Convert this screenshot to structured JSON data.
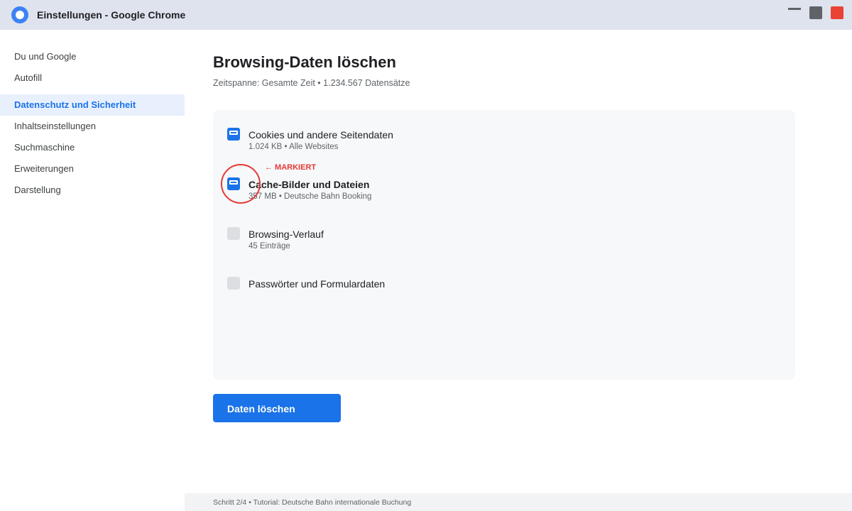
{
  "window": {
    "title": "Einstellungen - Google Chrome"
  },
  "sidebar": {
    "items": [
      {
        "label": "Du und Google"
      },
      {
        "label": "Autofill"
      },
      {
        "label": "Datenschutz und Sicherheit",
        "active": true
      },
      {
        "label": "Inhaltseinstellungen"
      },
      {
        "label": "Suchmaschine"
      },
      {
        "label": "Erweiterungen"
      },
      {
        "label": "Darstellung"
      }
    ]
  },
  "main": {
    "title": "Browsing-Daten löschen",
    "subtitle": "Zeitspanne: Gesamte Zeit • 1.234.567 Datensätze",
    "items": [
      {
        "label": "Cookies und andere Seitendaten",
        "meta": "1.024 KB • Alle Websites",
        "checked": true
      },
      {
        "label": "Cache-Bilder und Dateien",
        "meta": "357 MB • Deutsche Bahn Booking",
        "checked": true
      },
      {
        "label": "Browsing-Verlauf",
        "meta": "45 Einträge",
        "checked": false
      },
      {
        "label": "Passwörter und Formulardaten",
        "checked": false
      }
    ],
    "annotation": "← MARKIERT",
    "delete_button": "Daten löschen"
  },
  "footer": {
    "text": "Schritt 2/4 • Tutorial: Deutsche Bahn internationale Buchung"
  },
  "colors": {
    "accent": "#1a73e8",
    "annotation": "#e53935",
    "titlebar": "#dfe3ee",
    "close": "#ea4335"
  },
  "icons": {
    "browser_logo": "chrome-logo-icon",
    "minimize": "minimize-icon",
    "maximize": "maximize-icon",
    "close": "close-icon"
  }
}
